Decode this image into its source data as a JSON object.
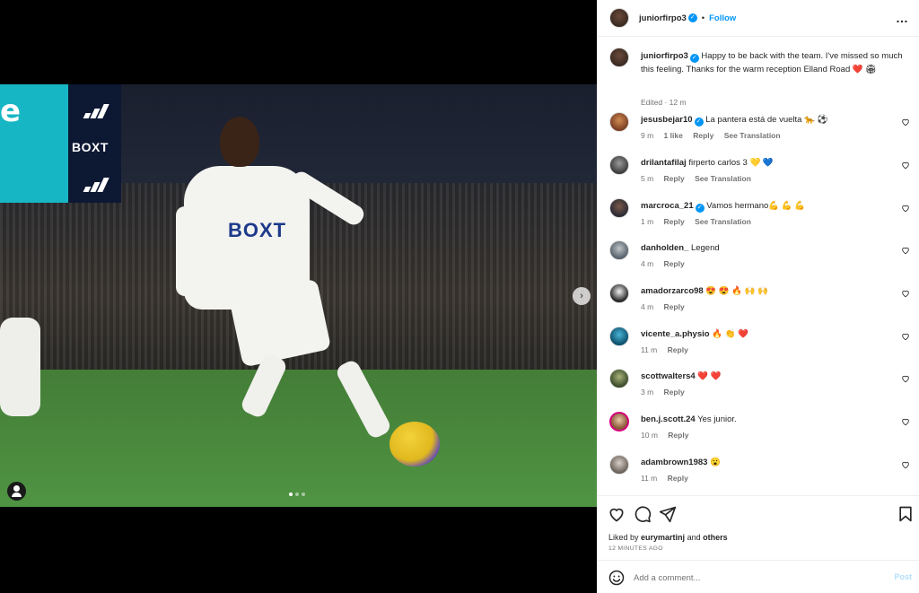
{
  "post": {
    "author": "juniorfirpo3",
    "follow_label": "Follow",
    "dot": "•",
    "more_icon": "…",
    "jersey_sponsor": "BOXT",
    "board_sponsor": "BOXT",
    "screen_letter": "e",
    "carousel": {
      "current": 1,
      "total": 3
    }
  },
  "caption": {
    "author": "juniorfirpo3",
    "text": "Happy to be back with the team. I've missed so much this feeling. Thanks for the warm reception Elland Road ❤️ 🏟",
    "meta": "Edited · 12 m"
  },
  "comments": [
    {
      "user": "jesusbejar10",
      "verified": true,
      "text": "La pantera está de vuelta 🐆 ⚽",
      "time": "9 m",
      "likes": "1 like",
      "reply": "Reply",
      "translate": "See Translation"
    },
    {
      "user": "drilantafilaj",
      "verified": false,
      "text": "firperto carlos 3 💛 💙",
      "time": "5 m",
      "reply": "Reply",
      "translate": "See Translation"
    },
    {
      "user": "marcroca_21",
      "verified": true,
      "text": "Vamos hermano💪 💪 💪",
      "time": "1 m",
      "reply": "Reply",
      "translate": "See Translation"
    },
    {
      "user": "danholden_",
      "verified": false,
      "text": "Legend",
      "time": "4 m",
      "reply": "Reply"
    },
    {
      "user": "amadorzarco98",
      "verified": false,
      "text": "😍 😍 🔥 🙌 🙌",
      "time": "4 m",
      "reply": "Reply"
    },
    {
      "user": "vicente_a.physio",
      "verified": false,
      "text": "🔥 👏 ❤️",
      "time": "11 m",
      "reply": "Reply"
    },
    {
      "user": "scottwalters4",
      "verified": false,
      "text": "❤️ ❤️",
      "time": "3 m",
      "reply": "Reply"
    },
    {
      "user": "ben.j.scott.24",
      "verified": false,
      "text": "Yes junior.",
      "time": "10 m",
      "reply": "Reply"
    },
    {
      "user": "adambrown1983",
      "verified": false,
      "text": "😮",
      "time": "11 m",
      "reply": "Reply"
    }
  ],
  "likes": {
    "prefix": "Liked by ",
    "user": "eurymartinj",
    "middle": " and ",
    "others": "others"
  },
  "timestamp": "12 MINUTES AGO",
  "composer": {
    "placeholder": "Add a comment...",
    "post_label": "Post"
  },
  "colors": {
    "accent": "#0095f6",
    "heart": "#ed4956",
    "muted": "#737373"
  }
}
